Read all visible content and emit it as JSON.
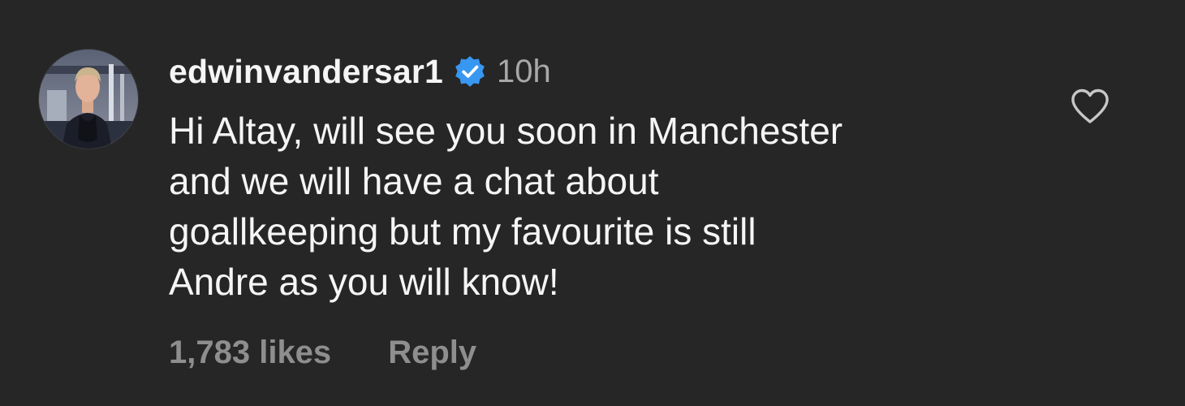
{
  "comment": {
    "username": "edwinvandersar1",
    "verified_icon": "verified-badge-icon",
    "timestamp": "10h",
    "lines": [
      "Hi Altay, will see you soon in Manchester",
      "and we will have a chat about",
      "goallkeeping but my favourite is still",
      "Andre as you will know!"
    ],
    "like_icon": "heart-outline-icon",
    "likes": "1,783 likes",
    "reply_label": "Reply"
  },
  "colors": {
    "background": "#262626",
    "primary_text": "#f5f5f5",
    "secondary_text": "#a8a8a8",
    "footer_text": "#8e8e8e",
    "verified_blue": "#3897f0"
  }
}
